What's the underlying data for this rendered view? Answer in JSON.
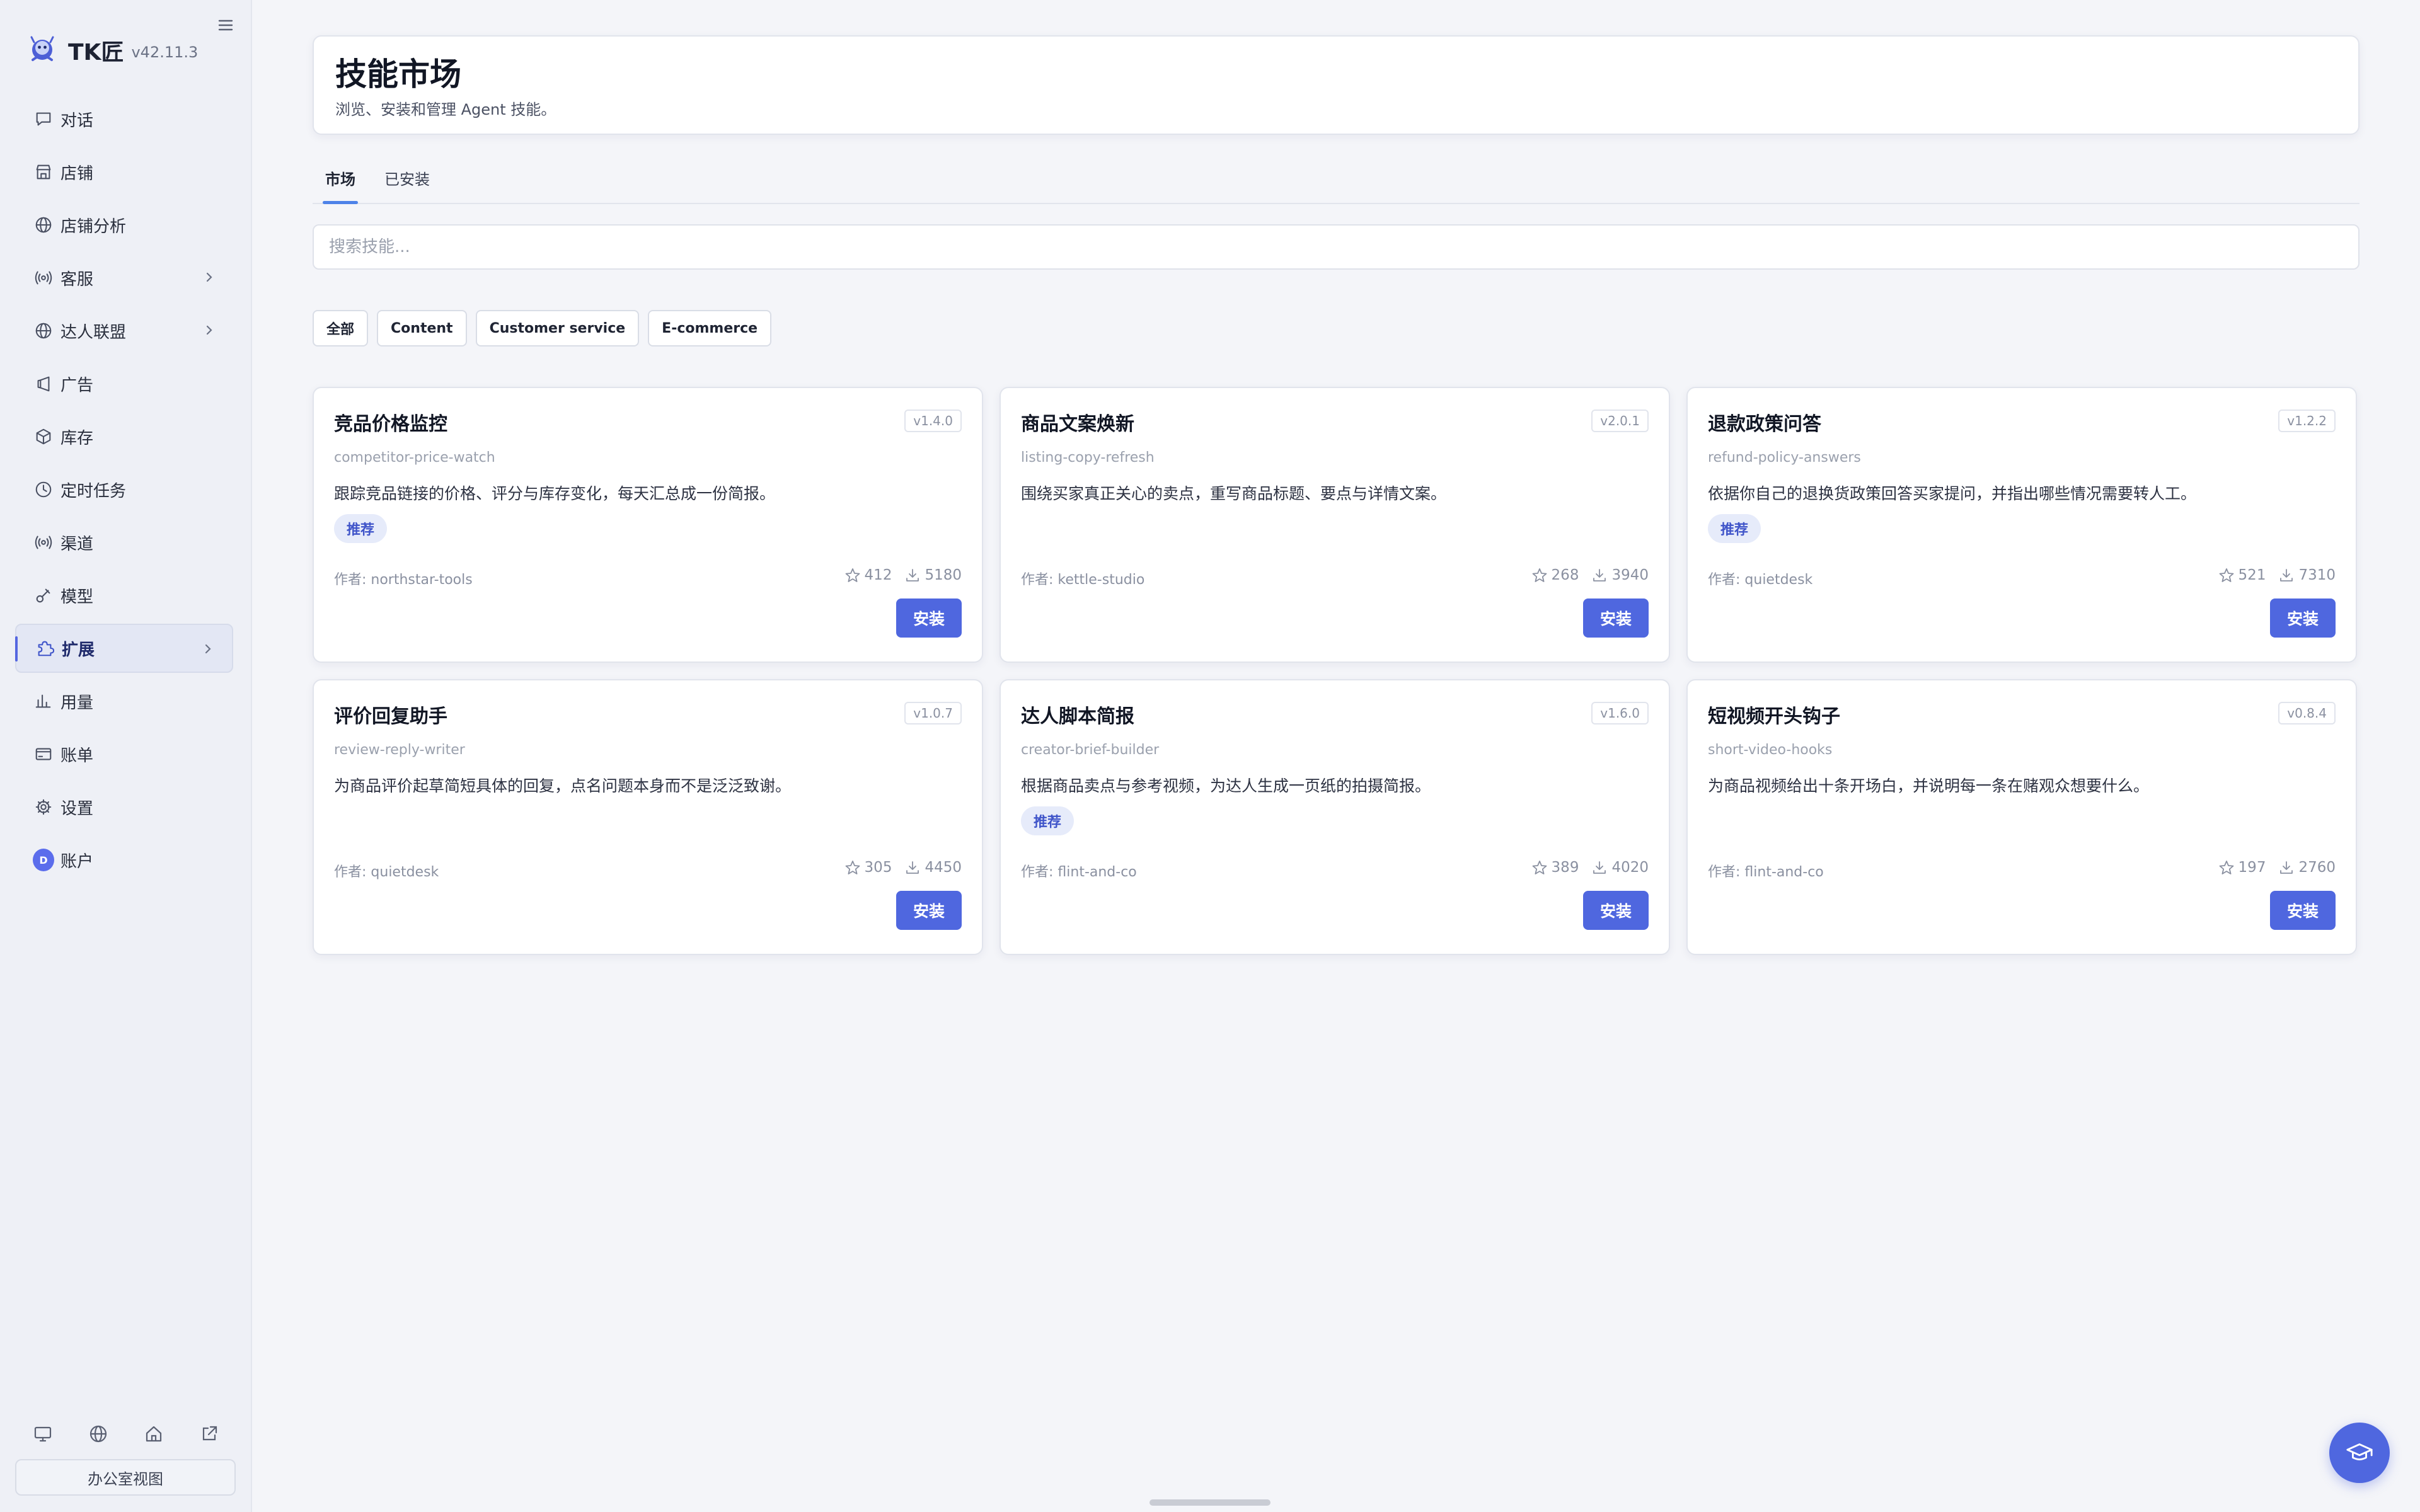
{
  "app": {
    "name": "TK匠",
    "version": "v42.11.3"
  },
  "sidebar": {
    "items": [
      {
        "label": "对话",
        "icon": "chat-icon",
        "active": false,
        "chevron": false
      },
      {
        "label": "店铺",
        "icon": "store-icon",
        "active": false,
        "chevron": false
      },
      {
        "label": "店铺分析",
        "icon": "globe-icon",
        "active": false,
        "chevron": false
      },
      {
        "label": "客服",
        "icon": "broadcast-icon",
        "active": false,
        "chevron": true
      },
      {
        "label": "达人联盟",
        "icon": "globe-icon",
        "active": false,
        "chevron": true
      },
      {
        "label": "广告",
        "icon": "megaphone-icon",
        "active": false,
        "chevron": false
      },
      {
        "label": "库存",
        "icon": "box-icon",
        "active": false,
        "chevron": false
      },
      {
        "label": "定时任务",
        "icon": "clock-icon",
        "active": false,
        "chevron": false
      },
      {
        "label": "渠道",
        "icon": "broadcast-icon",
        "active": false,
        "chevron": false
      },
      {
        "label": "模型",
        "icon": "model-icon",
        "active": false,
        "chevron": false
      },
      {
        "label": "扩展",
        "icon": "puzzle-icon",
        "active": true,
        "chevron": true
      },
      {
        "label": "用量",
        "icon": "bar-chart-icon",
        "active": false,
        "chevron": false
      },
      {
        "label": "账单",
        "icon": "card-icon",
        "active": false,
        "chevron": false
      },
      {
        "label": "设置",
        "icon": "gear-icon",
        "active": false,
        "chevron": false
      },
      {
        "label": "账户",
        "icon": "avatar",
        "avatar_letter": "D",
        "active": false,
        "chevron": false
      }
    ],
    "footer_icons": [
      "monitor-icon",
      "globe-icon",
      "home-icon",
      "external-link-icon"
    ],
    "office_view_label": "办公室视图"
  },
  "header": {
    "title": "技能市场",
    "subtitle": "浏览、安装和管理 Agent 技能。"
  },
  "tabs": [
    {
      "label": "市场",
      "active": true
    },
    {
      "label": "已安装",
      "active": false
    }
  ],
  "search": {
    "placeholder": "搜索技能...",
    "value": ""
  },
  "filters": [
    "全部",
    "Content",
    "Customer service",
    "E-commerce"
  ],
  "install_label": "安装",
  "skills": [
    {
      "title": "竞品价格监控",
      "version": "v1.4.0",
      "slug": "competitor-price-watch",
      "desc": "跟踪竞品链接的价格、评分与库存变化，每天汇总成一份简报。",
      "badge": "推荐",
      "author": "作者: northstar-tools",
      "stars": "412",
      "downloads": "5180"
    },
    {
      "title": "商品文案焕新",
      "version": "v2.0.1",
      "slug": "listing-copy-refresh",
      "desc": "围绕买家真正关心的卖点，重写商品标题、要点与详情文案。",
      "badge": "",
      "author": "作者: kettle-studio",
      "stars": "268",
      "downloads": "3940"
    },
    {
      "title": "退款政策问答",
      "version": "v1.2.2",
      "slug": "refund-policy-answers",
      "desc": "依据你自己的退换货政策回答买家提问，并指出哪些情况需要转人工。",
      "badge": "推荐",
      "author": "作者: quietdesk",
      "stars": "521",
      "downloads": "7310"
    },
    {
      "title": "评价回复助手",
      "version": "v1.0.7",
      "slug": "review-reply-writer",
      "desc": "为商品评价起草简短具体的回复，点名问题本身而不是泛泛致谢。",
      "badge": "",
      "author": "作者: quietdesk",
      "stars": "305",
      "downloads": "4450"
    },
    {
      "title": "达人脚本简报",
      "version": "v1.6.0",
      "slug": "creator-brief-builder",
      "desc": "根据商品卖点与参考视频，为达人生成一页纸的拍摄简报。",
      "badge": "推荐",
      "author": "作者: flint-and-co",
      "stars": "389",
      "downloads": "4020"
    },
    {
      "title": "短视频开头钩子",
      "version": "v0.8.4",
      "slug": "short-video-hooks",
      "desc": "为商品视频给出十条开场白，并说明每一条在赌观众想要什么。",
      "badge": "",
      "author": "作者: flint-and-co",
      "stars": "197",
      "downloads": "2760"
    }
  ],
  "colors": {
    "accent": "#4f67df",
    "badge_bg": "#e6ebfa",
    "badge_text": "#3f54c9",
    "tab_underline": "#4d82e8"
  }
}
